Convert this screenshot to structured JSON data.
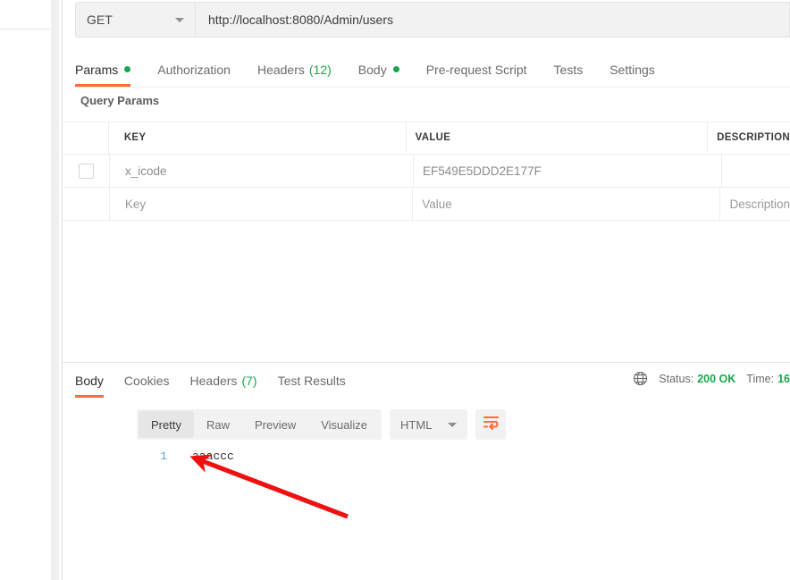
{
  "request": {
    "method": "GET",
    "url": "http://localhost:8080/Admin/users",
    "tabs": [
      {
        "label": "Params",
        "dot": true,
        "count": "",
        "active": true
      },
      {
        "label": "Authorization",
        "dot": false,
        "count": "",
        "active": false
      },
      {
        "label": "Headers",
        "dot": false,
        "count": "(12)",
        "active": false
      },
      {
        "label": "Body",
        "dot": true,
        "count": "",
        "active": false
      },
      {
        "label": "Pre-request Script",
        "dot": false,
        "count": "",
        "active": false
      },
      {
        "label": "Tests",
        "dot": false,
        "count": "",
        "active": false
      },
      {
        "label": "Settings",
        "dot": false,
        "count": "",
        "active": false
      }
    ]
  },
  "query_params": {
    "section_title": "Query Params",
    "columns": [
      "KEY",
      "VALUE",
      "DESCRIPTION"
    ],
    "rows": [
      {
        "checked": false,
        "key": "x_icode",
        "value": "EF549E5DDD2E177F",
        "description": ""
      },
      {
        "checked": false,
        "key": "Key",
        "value": "Value",
        "description": "Description"
      }
    ]
  },
  "response": {
    "tabs": [
      {
        "label": "Body",
        "count": "",
        "active": true
      },
      {
        "label": "Cookies",
        "count": "",
        "active": false
      },
      {
        "label": "Headers",
        "count": "(7)",
        "active": false
      },
      {
        "label": "Test Results",
        "count": "",
        "active": false
      }
    ],
    "meta": {
      "globe_icon": "globe-icon",
      "status_label": "Status:",
      "status_value": "200 OK",
      "time_label": "Time:",
      "time_value": "16"
    },
    "format_tabs": [
      {
        "label": "Pretty",
        "active": true
      },
      {
        "label": "Raw",
        "active": false
      },
      {
        "label": "Preview",
        "active": false
      },
      {
        "label": "Visualize",
        "active": false
      }
    ],
    "language": "HTML",
    "wrap_icon": "wrap-lines-icon",
    "body_lines": [
      {
        "number": "1",
        "text": "aaaccc"
      }
    ]
  },
  "colors": {
    "accent": "#ff6c37",
    "success": "#17a84c",
    "annotation": "#ee1111"
  }
}
